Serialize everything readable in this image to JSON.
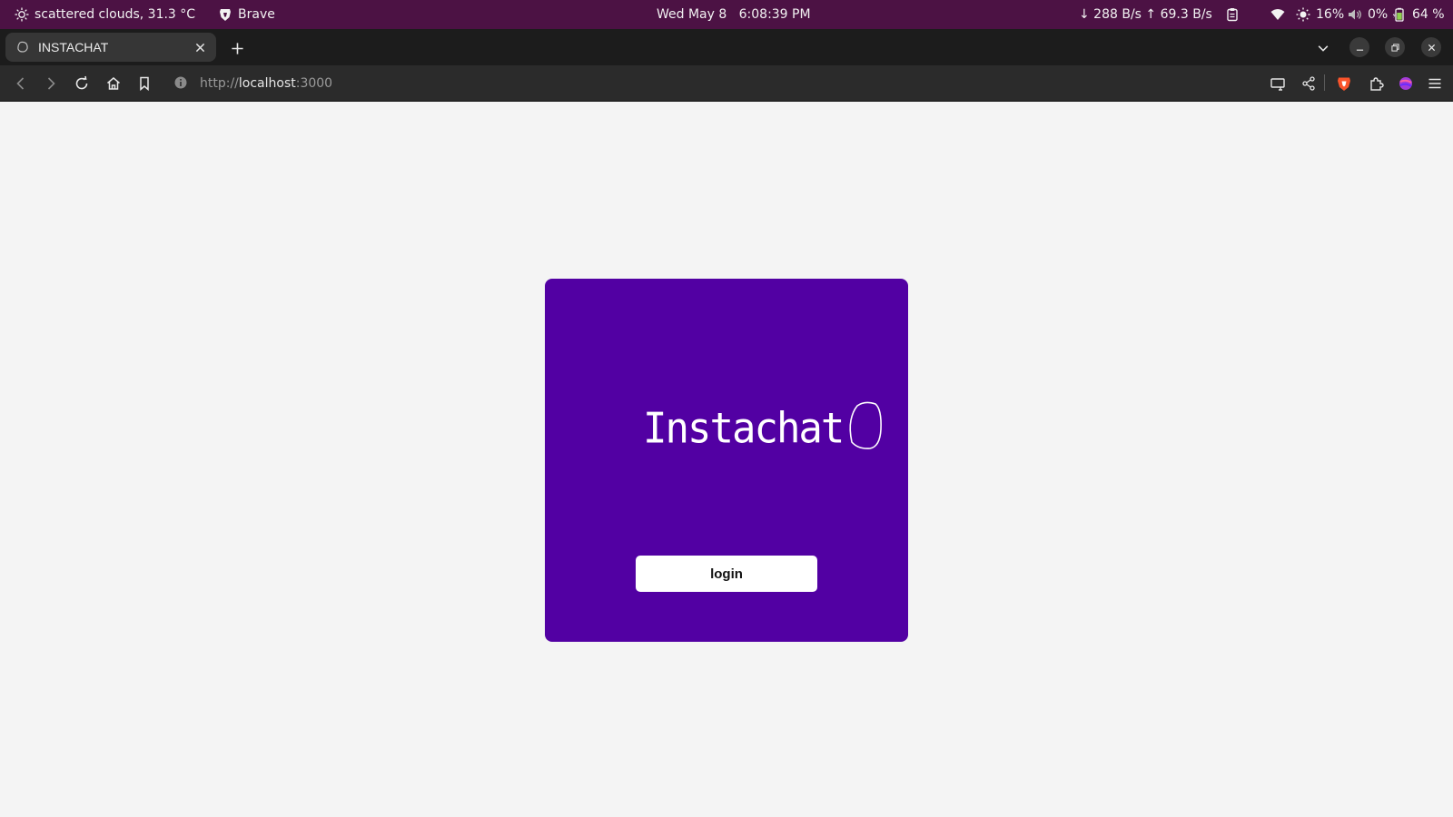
{
  "system_bar": {
    "weather": "scattered clouds, 31.3 °C",
    "app_name": "Brave",
    "datetime": "Wed May 8   6:08:39 PM",
    "network": "↓ 288 B/s ↑ 69.3 B/s",
    "brightness": "16%",
    "volume": "0%",
    "battery": "64 %"
  },
  "browser": {
    "tab_title": "INSTACHAT",
    "url_scheme": "http://",
    "url_host": "localhost",
    "url_port": ":3000"
  },
  "page": {
    "logo_text": "Instachat",
    "login_label": "login",
    "card_color": "#5200a3"
  }
}
